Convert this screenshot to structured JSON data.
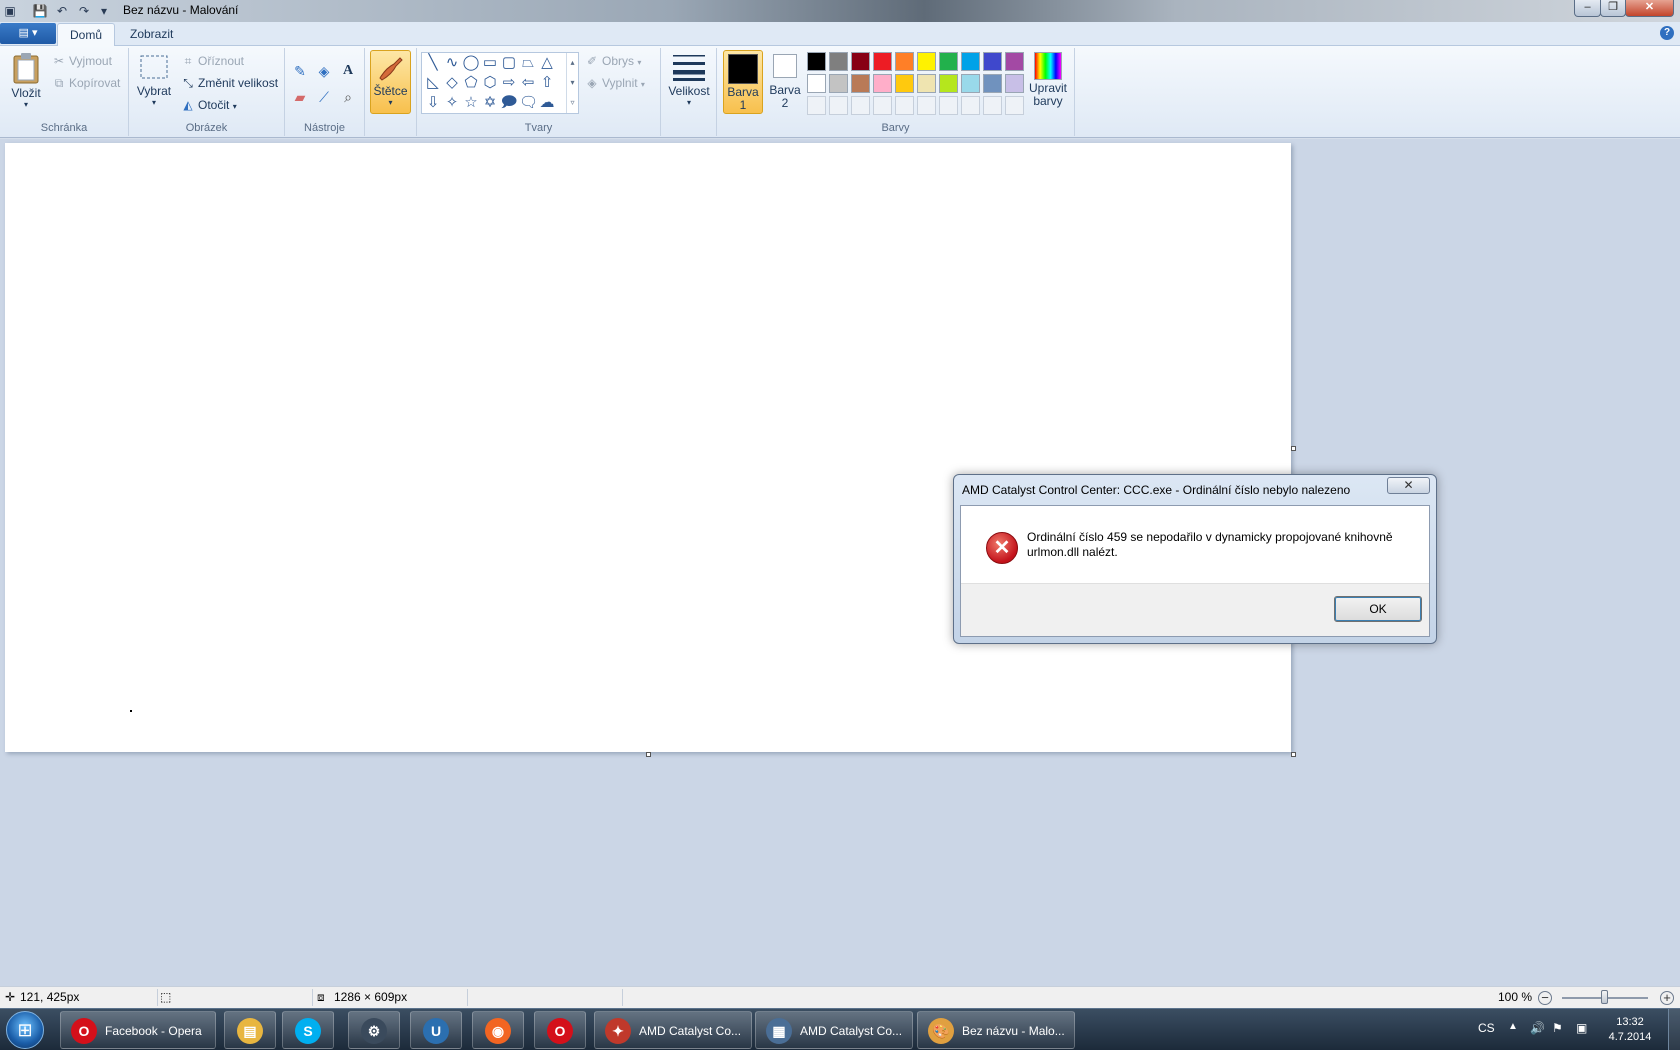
{
  "window": {
    "title": "Bez názvu - Malování",
    "controls": {
      "minimize": "–",
      "maximize": "❐",
      "close": "✕"
    }
  },
  "quick_access": [
    "save-icon",
    "undo-icon",
    "redo-icon",
    "customize-icon"
  ],
  "tabs": [
    {
      "label": "Domů",
      "active": true
    },
    {
      "label": "Zobrazit",
      "active": false
    }
  ],
  "ribbon": {
    "clipboard": {
      "label": "Schránka",
      "paste": "Vložit",
      "cut": "Vyjmout",
      "copy": "Kopírovat"
    },
    "image": {
      "label": "Obrázek",
      "select": "Vybrat",
      "crop": "Oříznout",
      "resize": "Změnit velikost",
      "rotate": "Otočit"
    },
    "tools": {
      "label": "Nástroje"
    },
    "brushes": {
      "label": "Štětce"
    },
    "shapes": {
      "label": "Tvary",
      "outline": "Obrys",
      "fill": "Vyplnit"
    },
    "size": {
      "label": "Velikost"
    },
    "colors": {
      "label": "Barvy",
      "color1": "Barva 1",
      "color2": "Barva 2",
      "edit": "Upravit barvy",
      "color1_value": "#000000",
      "color2_value": "#ffffff",
      "row1": [
        "#000000",
        "#7f7f7f",
        "#880015",
        "#ed1c24",
        "#ff7f27",
        "#fff200",
        "#22b14c",
        "#00a2e8",
        "#3f48cc",
        "#a349a4"
      ],
      "row2": [
        "#ffffff",
        "#c3c3c3",
        "#b97a57",
        "#ffaec9",
        "#ffc90e",
        "#efe4b0",
        "#b5e61d",
        "#99d9ea",
        "#7092be",
        "#c8bfe7"
      ]
    }
  },
  "dialog": {
    "title": "AMD Catalyst Control Center: CCC.exe - Ordinální číslo nebylo nalezeno",
    "message": "Ordinální číslo 459 se nepodařilo v dynamicky propojované knihovně urlmon.dll nalézt.",
    "ok": "OK",
    "close": "✕"
  },
  "statusbar": {
    "cursor_pos": "121, 425px",
    "image_size": "1286 × 609px",
    "zoom": "100 %",
    "zoom_fraction": 0.5
  },
  "taskbar": {
    "items": [
      {
        "label": "Facebook - Opera",
        "icon": "opera-icon",
        "color": "#d4101a"
      },
      {
        "label": "",
        "icon": "explorer-icon",
        "color": "#e8b640"
      },
      {
        "label": "",
        "icon": "skype-icon",
        "color": "#00aff0"
      },
      {
        "label": "",
        "icon": "steam-icon",
        "color": "#3a4a5c"
      },
      {
        "label": "",
        "icon": "uplay-icon",
        "color": "#2b6fb0"
      },
      {
        "label": "",
        "icon": "origin-icon",
        "color": "#f26522"
      },
      {
        "label": "",
        "icon": "opera-icon",
        "color": "#d4101a"
      },
      {
        "label": "AMD Catalyst Co...",
        "icon": "amd-icon",
        "color": "#c0392b"
      },
      {
        "label": "AMD Catalyst Co...",
        "icon": "window-icon",
        "color": "#4a6e96"
      },
      {
        "label": "Bez názvu - Malo...",
        "icon": "paint-icon",
        "color": "#e0a040"
      }
    ],
    "lang": "CS",
    "time": "13:32",
    "date": "4.7.2014"
  }
}
